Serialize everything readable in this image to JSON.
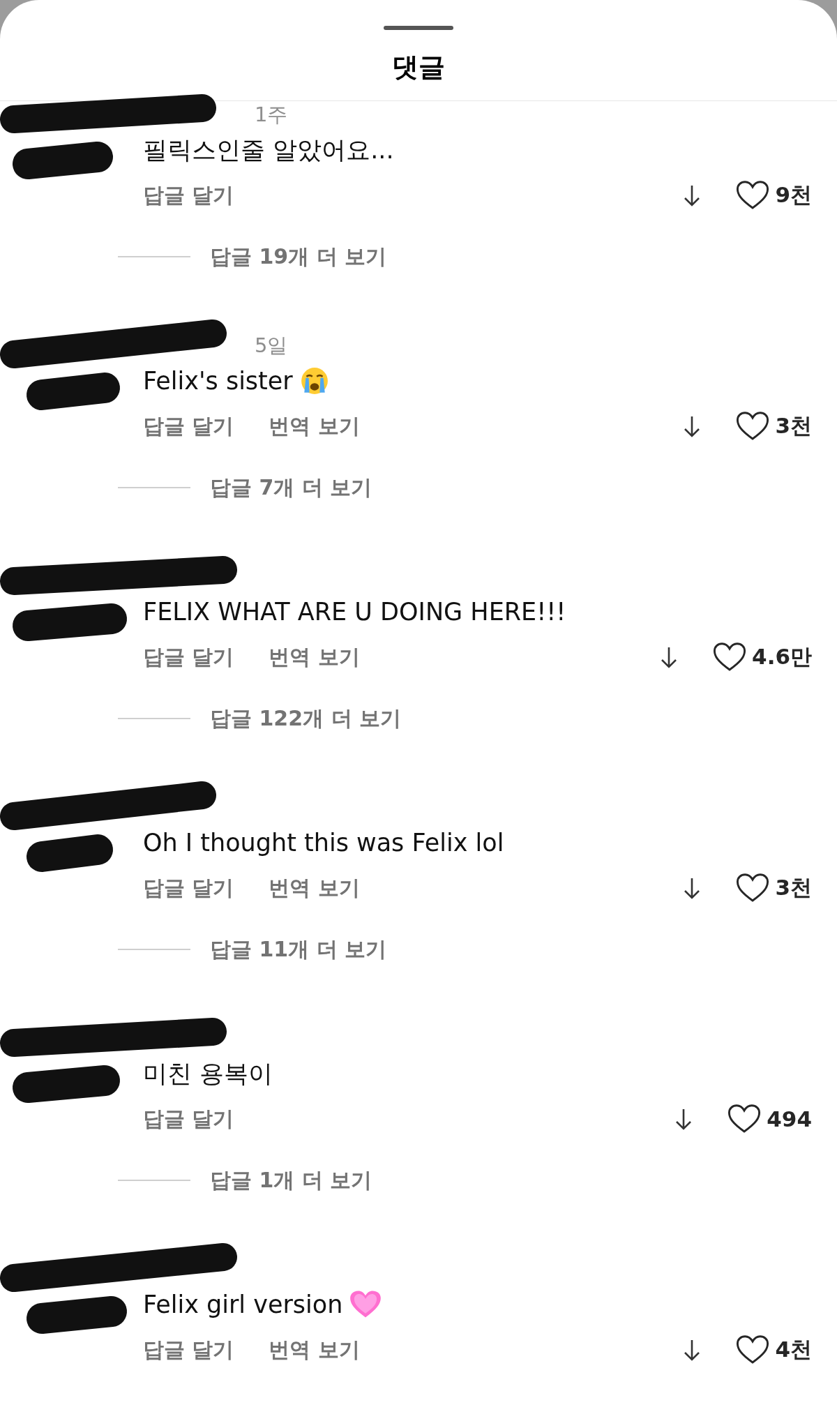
{
  "sheet": {
    "title": "댓글"
  },
  "comments": [
    {
      "time": "1주",
      "text": "필릭스인줄 알았어요...",
      "actions": [
        "답글 달기"
      ],
      "likes": "9천",
      "more_replies": "답글 19개 더 보기"
    },
    {
      "time": "5일",
      "text": "Felix's sister",
      "emoji": {
        "kind": "crying"
      },
      "actions": [
        "답글 달기",
        "번역 보기"
      ],
      "likes": "3천",
      "more_replies": "답글 7개 더 보기"
    },
    {
      "text": "FELIX WHAT ARE U DOING HERE!!!",
      "actions": [
        "답글 달기",
        "번역 보기"
      ],
      "likes": "4.6만",
      "more_replies": "답글 122개 더 보기"
    },
    {
      "text": "Oh I thought this was Felix lol",
      "actions": [
        "답글 달기",
        "번역 보기"
      ],
      "likes": "3천",
      "more_replies": "답글 11개 더 보기"
    },
    {
      "text": "미친 용복이",
      "actions": [
        "답글 달기"
      ],
      "likes": "494",
      "more_replies": "답글 1개 더 보기"
    },
    {
      "text": "Felix girl version",
      "emoji": {
        "kind": "heart"
      },
      "actions": [
        "답글 달기",
        "번역 보기"
      ],
      "likes": "4천"
    }
  ]
}
